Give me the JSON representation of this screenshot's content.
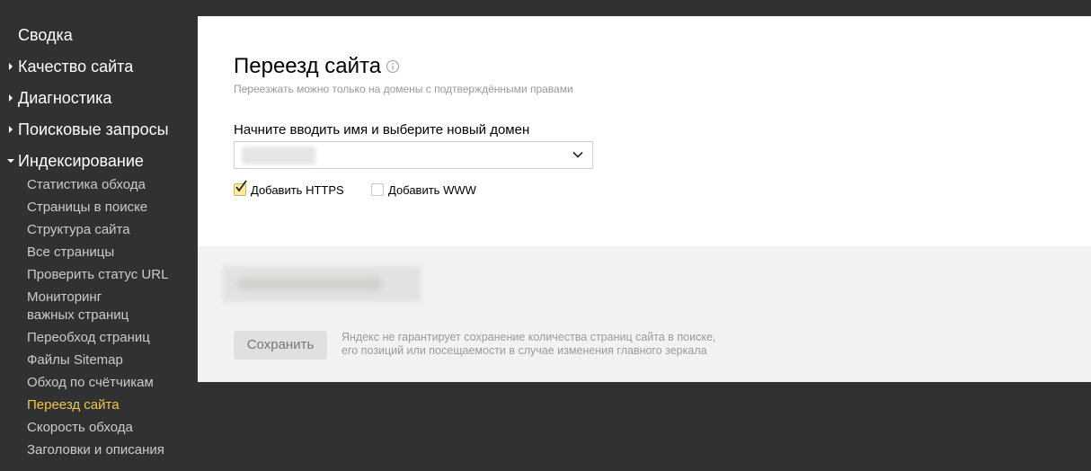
{
  "sidebar": {
    "top_items": [
      {
        "label": "Сводка",
        "arrow": "none"
      },
      {
        "label": "Качество сайта",
        "arrow": "right"
      },
      {
        "label": "Диагностика",
        "arrow": "right"
      },
      {
        "label": "Поисковые запросы",
        "arrow": "right"
      },
      {
        "label": "Индексирование",
        "arrow": "down"
      }
    ],
    "sub_items": [
      {
        "label": "Статистика обхода"
      },
      {
        "label": "Страницы в поиске"
      },
      {
        "label": "Структура сайта"
      },
      {
        "label": "Все страницы"
      },
      {
        "label": "Проверить статус URL"
      },
      {
        "label_line1": "Мониторинг",
        "label_line2": "важных страниц"
      },
      {
        "label": "Переобход страниц"
      },
      {
        "label": "Файлы Sitemap"
      },
      {
        "label": "Обход по счётчикам"
      },
      {
        "label": "Переезд сайта",
        "active": true
      },
      {
        "label": "Скорость обхода"
      },
      {
        "label": "Заголовки и описания"
      }
    ],
    "active_color": "#f5c53d"
  },
  "main": {
    "title": "Переезд сайта",
    "info_icon": "info-circle-icon",
    "subtitle": "Переезжать можно только на домены с подтверждёнными правами",
    "domain_field": {
      "label": "Начните вводить имя и выберите новый домен",
      "value_hidden": true,
      "icon": "chevron-down-icon"
    },
    "checkboxes": [
      {
        "label": "Добавить HTTPS",
        "checked": true
      },
      {
        "label": "Добавить WWW",
        "checked": false
      }
    ],
    "save_button": "Сохранить",
    "notice_line1": "Яндекс не гарантирует сохранение количества страниц сайта в поиске,",
    "notice_line2": "его позиций или посещаемости в случае изменения главного зеркала"
  },
  "colors": {
    "sidebar_bg": "#2f3133",
    "panel_bg": "#ffffff",
    "footer_bg": "#f3f2f0",
    "checkbox_checked": "#ffeba0"
  }
}
